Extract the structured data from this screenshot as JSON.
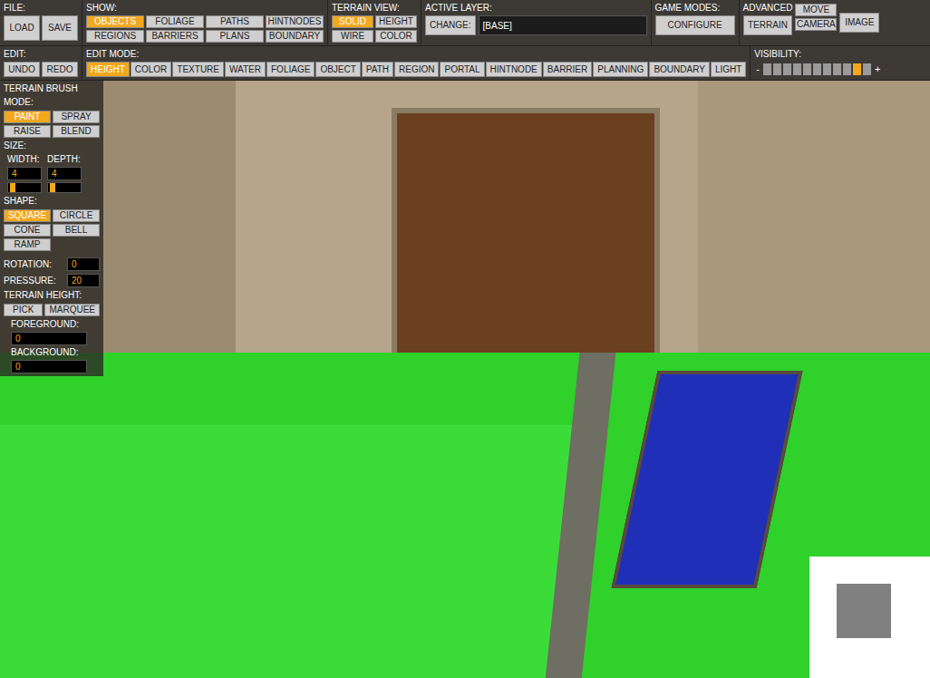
{
  "toolbar": {
    "file": {
      "label": "FILE:",
      "buttons": [
        "LOAD",
        "SAVE"
      ]
    },
    "show": {
      "label": "SHOW:",
      "items": [
        {
          "label": "OBJECTS",
          "selected": true
        },
        {
          "label": "FOLIAGE",
          "selected": false
        },
        {
          "label": "PATHS",
          "selected": false
        },
        {
          "label": "HINTNODES",
          "selected": false
        },
        {
          "label": "REGIONS",
          "selected": false
        },
        {
          "label": "BARRIERS",
          "selected": false
        },
        {
          "label": "PLANS",
          "selected": false
        },
        {
          "label": "BOUNDARY",
          "selected": false
        }
      ]
    },
    "terrain_view": {
      "label": "TERRAIN VIEW:",
      "items": [
        {
          "label": "SOLID",
          "selected": true
        },
        {
          "label": "HEIGHT",
          "selected": false
        },
        {
          "label": "WIRE",
          "selected": false
        },
        {
          "label": "COLOR",
          "selected": false
        }
      ]
    },
    "active_layer": {
      "label": "ACTIVE LAYER:",
      "button": "CHANGE:",
      "value": "[BASE]"
    },
    "game_modes": {
      "label": "GAME MODES:",
      "button": "CONFIGURE"
    },
    "advanced": {
      "label": "ADVANCED",
      "buttons": [
        "TERRAIN",
        "MOVE",
        "CAMERA",
        "IMAGE"
      ]
    }
  },
  "edit": {
    "label": "EDIT:",
    "buttons": [
      "UNDO",
      "REDO"
    ]
  },
  "edit_mode": {
    "label": "EDIT MODE:",
    "items": [
      {
        "label": "HEIGHT",
        "selected": true
      },
      {
        "label": "COLOR",
        "selected": false
      },
      {
        "label": "TEXTURE",
        "selected": false
      },
      {
        "label": "WATER",
        "selected": false
      },
      {
        "label": "FOLIAGE",
        "selected": false
      },
      {
        "label": "OBJECT",
        "selected": false
      },
      {
        "label": "PATH",
        "selected": false
      },
      {
        "label": "REGION",
        "selected": false
      },
      {
        "label": "PORTAL",
        "selected": false
      },
      {
        "label": "HINTNODE",
        "selected": false
      },
      {
        "label": "BARRIER",
        "selected": false
      },
      {
        "label": "PLANNING",
        "selected": false
      },
      {
        "label": "BOUNDARY",
        "selected": false
      },
      {
        "label": "LIGHT",
        "selected": false
      }
    ]
  },
  "visibility": {
    "label": "VISIBILITY:",
    "minus": "-",
    "plus": "+",
    "segments": [
      {
        "selected": false
      },
      {
        "selected": false
      },
      {
        "selected": false
      },
      {
        "selected": false
      },
      {
        "selected": false
      },
      {
        "selected": false
      },
      {
        "selected": false
      },
      {
        "selected": false
      },
      {
        "selected": false
      },
      {
        "selected": true
      },
      {
        "selected": false
      }
    ]
  },
  "terrain_brush": {
    "title": "TERRAIN BRUSH",
    "mode": {
      "label": "MODE:",
      "items": [
        {
          "label": "PAINT",
          "selected": true
        },
        {
          "label": "SPRAY",
          "selected": false
        },
        {
          "label": "RAISE",
          "selected": false
        },
        {
          "label": "BLEND",
          "selected": false
        }
      ]
    },
    "size": {
      "label": "SIZE:",
      "width": {
        "label": "WIDTH:",
        "value": "4",
        "level": 0.05
      },
      "depth": {
        "label": "DEPTH:",
        "value": "4",
        "level": 0.05
      }
    },
    "shape": {
      "label": "SHAPE:",
      "items": [
        {
          "label": "SQUARE",
          "selected": true
        },
        {
          "label": "CIRCLE",
          "selected": false
        },
        {
          "label": "CONE",
          "selected": false
        },
        {
          "label": "BELL",
          "selected": false
        },
        {
          "label": "RAMP",
          "selected": false
        }
      ]
    },
    "rotation": {
      "label": "ROTATION:",
      "value": "0"
    },
    "pressure": {
      "label": "PRESSURE:",
      "value": "20"
    },
    "terrain_height": {
      "label": "TERRAIN HEIGHT:",
      "buttons": [
        "PICK",
        "MARQUEE"
      ]
    },
    "foreground": {
      "label": "FOREGROUND:",
      "value": "0"
    },
    "background": {
      "label": "BACKGROUND:",
      "value": "0"
    }
  }
}
